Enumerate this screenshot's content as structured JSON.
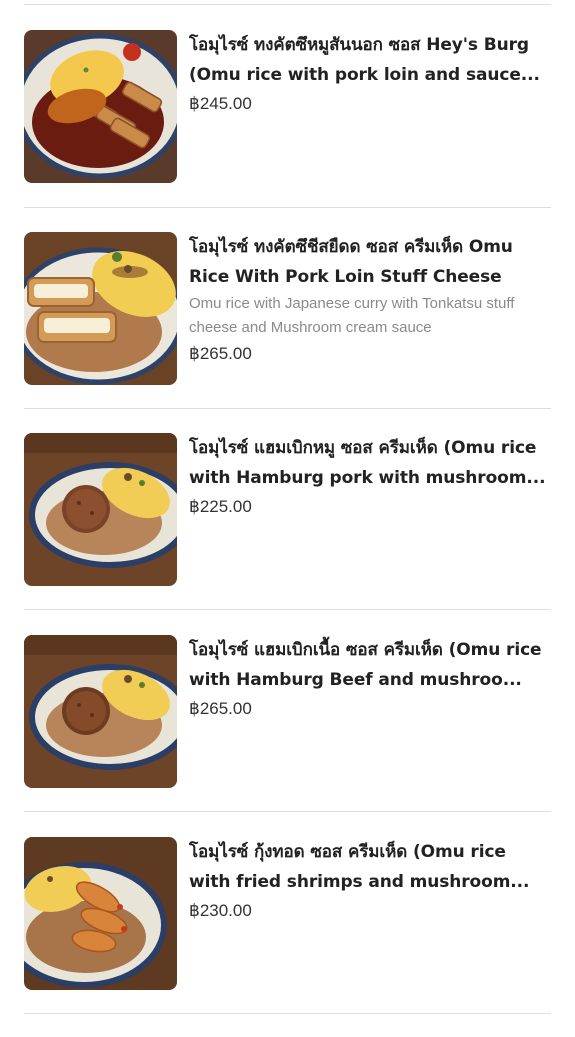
{
  "menu": {
    "items": [
      {
        "name": "โอมุไรซ์ ทงคัตซึหมูสันนอก ซอส Hey's Burg (Omu rice with pork loin and sauce...",
        "description": "",
        "price": "฿245.00",
        "image": "omurice-tonkatsu-dish"
      },
      {
        "name": "โอมุไรซ์ ทงคัตซึชีสยืดด ซอส ครีมเห็ด Omu Rice With Pork Loin Stuff Cheese",
        "description": "Omu rice with Japanese curry with Tonkatsu stuff cheese and Mushroom cream sauce",
        "price": "฿265.00",
        "image": "omurice-cheese-katsu-dish"
      },
      {
        "name": "โอมุไรซ์ แฮมเบิกหมู ซอส ครีมเห็ด (Omu rice with Hamburg pork with mushroom...",
        "description": "",
        "price": "฿225.00",
        "image": "omurice-hamburg-pork-dish"
      },
      {
        "name": "โอมุไรซ์ แฮมเบิกเนื้อ ซอส ครีมเห็ด (Omu rice with Hamburg Beef and mushroo...",
        "description": "",
        "price": "฿265.00",
        "image": "omurice-hamburg-beef-dish"
      },
      {
        "name": "โอมุไรซ์ กุ้งทอด ซอส ครีมเห็ด (Omu rice with fried shrimps and mushroom...",
        "description": "",
        "price": "฿230.00",
        "image": "omurice-fried-shrimp-dish"
      }
    ]
  }
}
